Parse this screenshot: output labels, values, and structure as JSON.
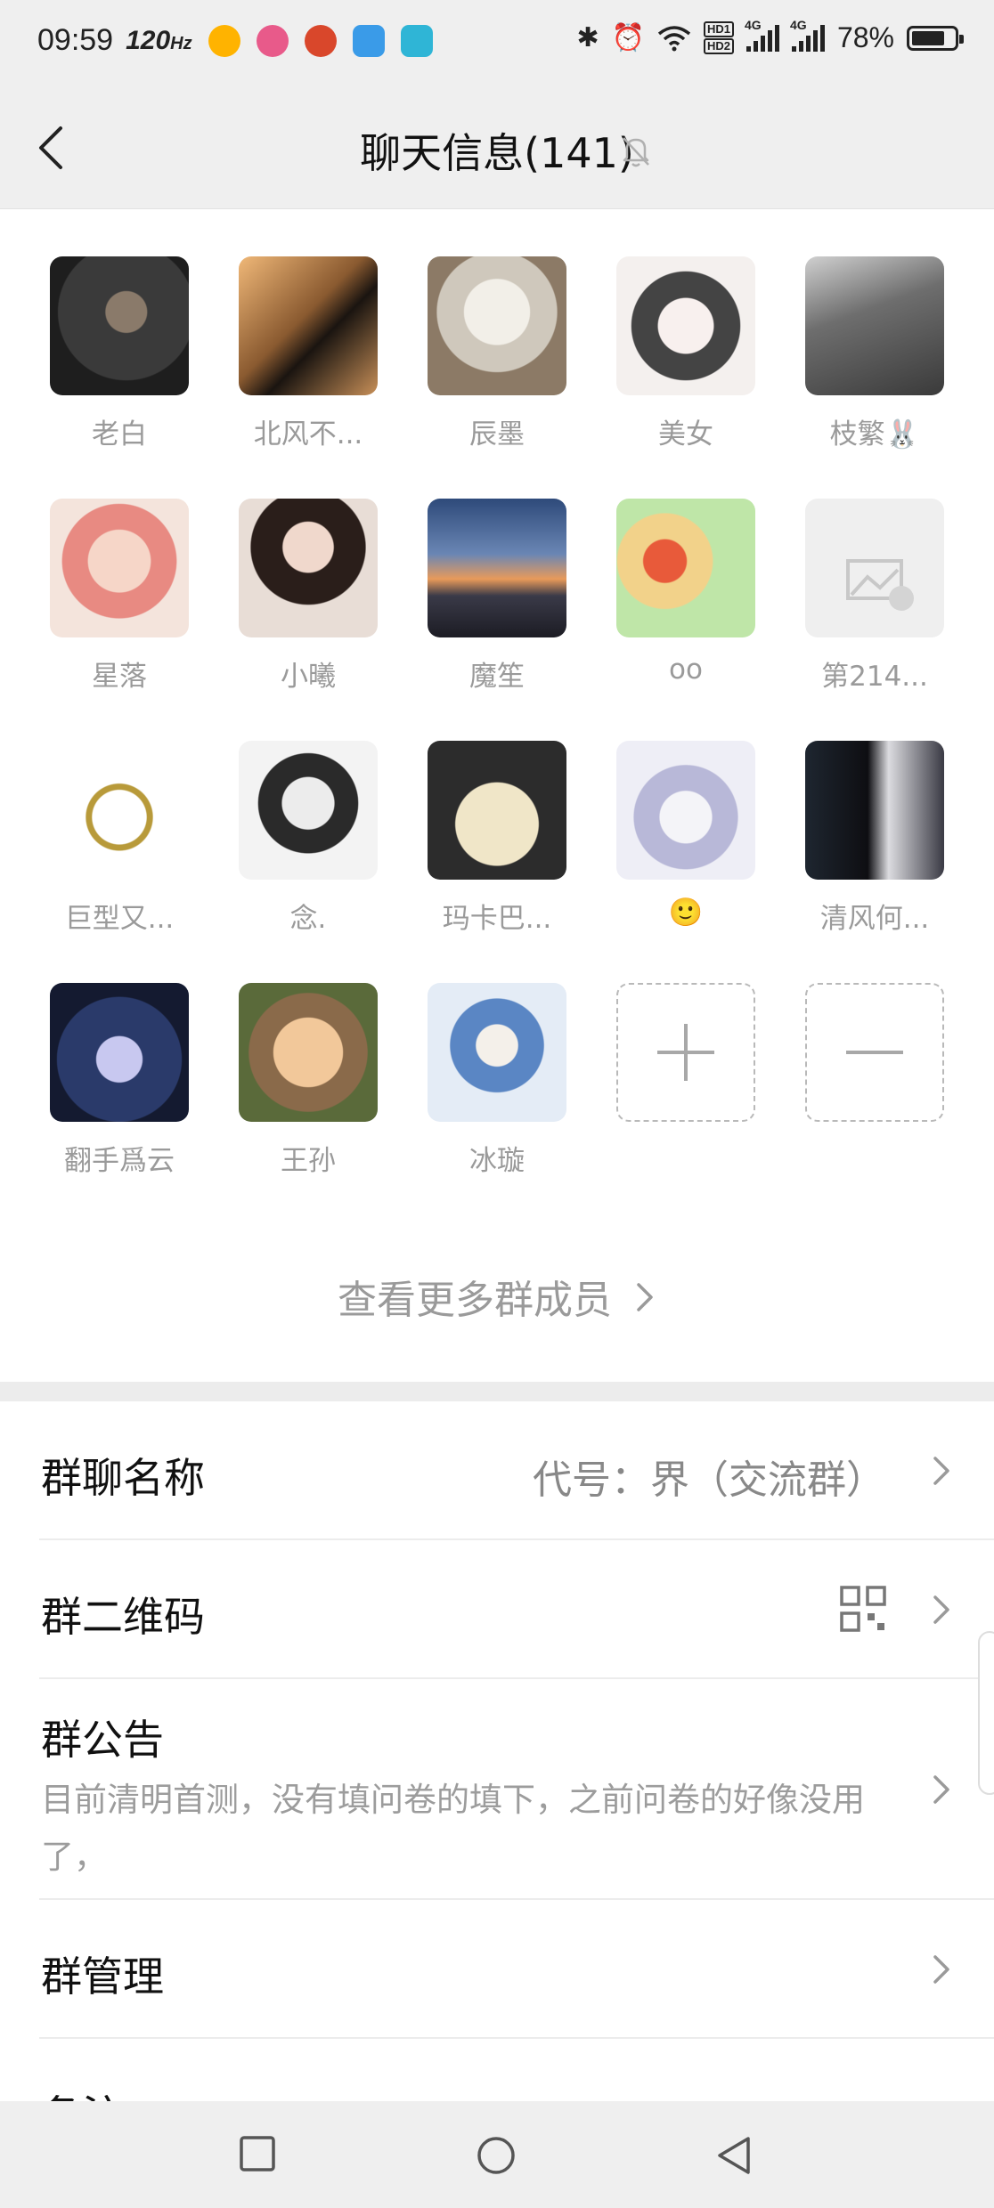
{
  "status_bar": {
    "time": "09:59",
    "refresh_rate": "120",
    "refresh_unit": "Hz",
    "battery_percent": "78%",
    "battery_level": 0.78,
    "network_1": "4G",
    "network_2": "4G",
    "hd_1": "HD1",
    "hd_2": "HD2"
  },
  "header": {
    "title": "聊天信息(141)"
  },
  "members": [
    {
      "name": "老白"
    },
    {
      "name": "北风不..."
    },
    {
      "name": "辰墨"
    },
    {
      "name": "美女"
    },
    {
      "name": "枝繁🐰"
    },
    {
      "name": "星落"
    },
    {
      "name": "小曦"
    },
    {
      "name": "魔笙"
    },
    {
      "name": "oo"
    },
    {
      "name": "第214..."
    },
    {
      "name": "巨型又..."
    },
    {
      "name": "念."
    },
    {
      "name": "玛卡巴..."
    },
    {
      "name": "🙂"
    },
    {
      "name": "清风何..."
    },
    {
      "name": "翻手爲云"
    },
    {
      "name": "王孙"
    },
    {
      "name": "冰璇"
    }
  ],
  "more_members_label": "查看更多群成员",
  "settings": {
    "group_name_label": "群聊名称",
    "group_name_value": "代号：界（交流群）",
    "qr_label": "群二维码",
    "notice_label": "群公告",
    "notice_text": "目前清明首测，没有填问卷的填下，之前问卷的好像没用了，",
    "manage_label": "群管理",
    "remark_label": "备注"
  },
  "colors": {
    "bar_bg": "#efefef",
    "secondary_text": "#9a9a9a"
  }
}
